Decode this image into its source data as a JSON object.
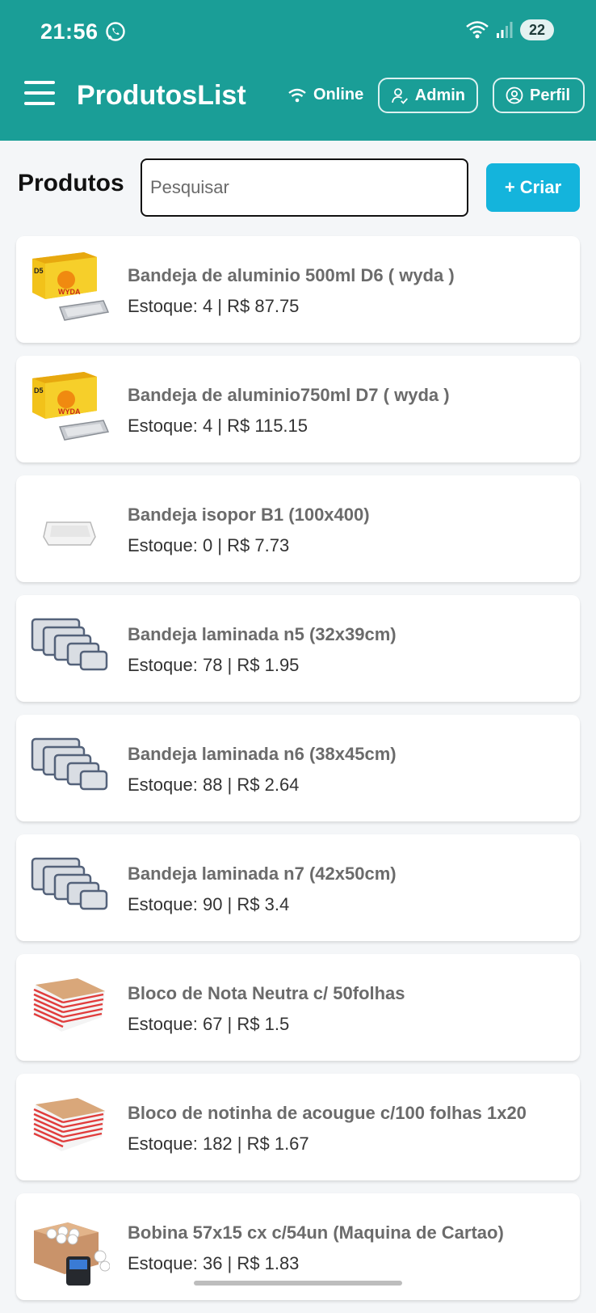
{
  "status_bar": {
    "time": "21:56",
    "battery": "22"
  },
  "app_bar": {
    "title": "ProdutosList",
    "online_label": "Online",
    "admin_label": "Admin",
    "perfil_label": "Perfil"
  },
  "toolbar": {
    "heading": "Produtos",
    "search_placeholder": "Pesquisar",
    "create_label": "+ Criar"
  },
  "products": [
    {
      "name": "Bandeja de aluminio 500ml D6 ( wyda )",
      "info": "Estoque: 4 | R$ 87.75",
      "image": "aluminum-tray-box-icon"
    },
    {
      "name": "Bandeja de aluminio750ml D7 ( wyda )",
      "info": "Estoque: 4 | R$ 115.15",
      "image": "aluminum-tray-box-icon"
    },
    {
      "name": "Bandeja isopor B1 (100x400)",
      "info": "Estoque: 0 | R$ 7.73",
      "image": "styrofoam-tray-icon"
    },
    {
      "name": "Bandeja laminada n5 (32x39cm)",
      "info": "Estoque: 78 | R$ 1.95",
      "image": "laminated-trays-icon"
    },
    {
      "name": "Bandeja laminada n6 (38x45cm)",
      "info": "Estoque: 88 | R$ 2.64",
      "image": "laminated-trays-icon"
    },
    {
      "name": "Bandeja laminada n7 (42x50cm)",
      "info": "Estoque: 90 | R$ 3.4",
      "image": "laminated-trays-icon"
    },
    {
      "name": "Bloco de Nota Neutra c/ 50folhas",
      "info": "Estoque: 67 | R$ 1.5",
      "image": "note-pad-icon"
    },
    {
      "name": "Bloco de notinha de acougue c/100 folhas 1x20",
      "info": "Estoque: 182 | R$ 1.67",
      "image": "note-pad-icon"
    },
    {
      "name": "Bobina 57x15 cx c/54un (Maquina de Cartao)",
      "info": "Estoque: 36 | R$ 1.83",
      "image": "paper-roll-box-icon"
    }
  ]
}
